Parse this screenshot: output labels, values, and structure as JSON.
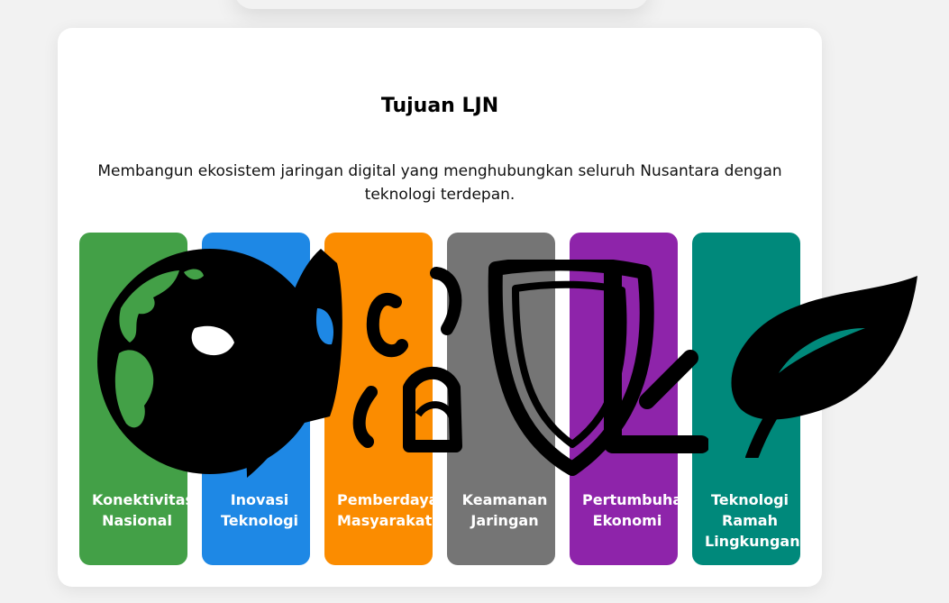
{
  "section": {
    "title": "Tujuan LJN",
    "description": "Membangun ekosistem jaringan digital yang menghubungkan seluruh Nusantara dengan teknologi terdepan."
  },
  "goals": [
    {
      "label": "Konektivitas Nasional",
      "color": "#43a047",
      "icon": "globe-icon"
    },
    {
      "label": "Inovasi Teknologi",
      "color": "#1e88e5",
      "icon": "rocket-icon"
    },
    {
      "label": "Pemberdayaan Masyarakat",
      "color": "#fb8c00",
      "icon": "people-icon"
    },
    {
      "label": "Keamanan Jaringan",
      "color": "#757575",
      "icon": "shield-icon"
    },
    {
      "label": "Pertumbuhan Ekonomi",
      "color": "#8e24aa",
      "icon": "chart-icon"
    },
    {
      "label": "Teknologi Ramah Lingkungan",
      "color": "#00897b",
      "icon": "leaf-icon"
    }
  ]
}
